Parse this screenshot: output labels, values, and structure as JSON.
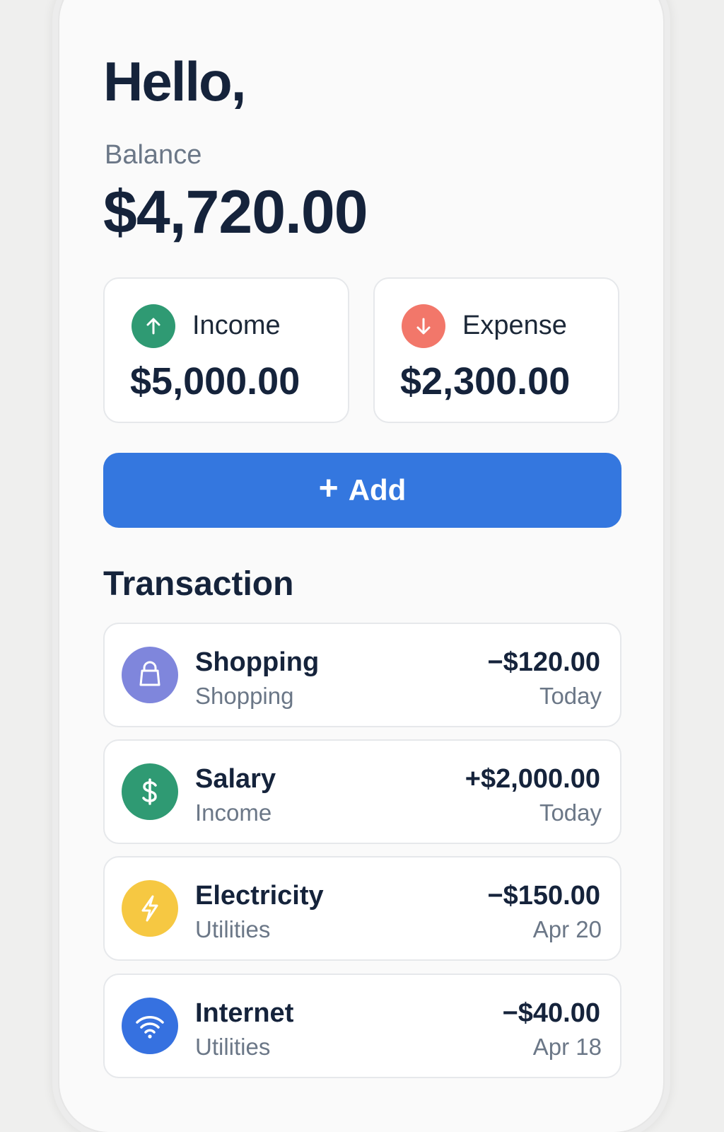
{
  "header": {
    "greeting": "Hello,",
    "balance_label": "Balance",
    "balance_amount": "$4,720.00"
  },
  "summary": {
    "income": {
      "label": "Income",
      "amount": "$5,000.00",
      "icon": "arrow-up-icon",
      "color": "#2f9a73"
    },
    "expense": {
      "label": "Expense",
      "amount": "$2,300.00",
      "icon": "arrow-down-icon",
      "color": "#f2776a"
    }
  },
  "actions": {
    "add_plus": "+",
    "add_label": "Add",
    "button_color": "#3477df"
  },
  "transactions": {
    "title": "Transaction",
    "items": [
      {
        "title": "Shopping",
        "category": "Shopping",
        "amount": "−$120.00",
        "date": "Today",
        "icon": "shopping-bag-icon",
        "color": "#7f86dc"
      },
      {
        "title": "Salary",
        "category": "Income",
        "amount": "+$2,000.00",
        "date": "Today",
        "icon": "dollar-icon",
        "color": "#2f9a73"
      },
      {
        "title": "Electricity",
        "category": "Utilities",
        "amount": "−$150.00",
        "date": "Apr 20",
        "icon": "lightning-bolt-icon",
        "color": "#f6c842"
      },
      {
        "title": "Internet",
        "category": "Utilities",
        "amount": "−$40.00",
        "date": "Apr 18",
        "icon": "wifi-icon",
        "color": "#3671e0"
      }
    ]
  }
}
